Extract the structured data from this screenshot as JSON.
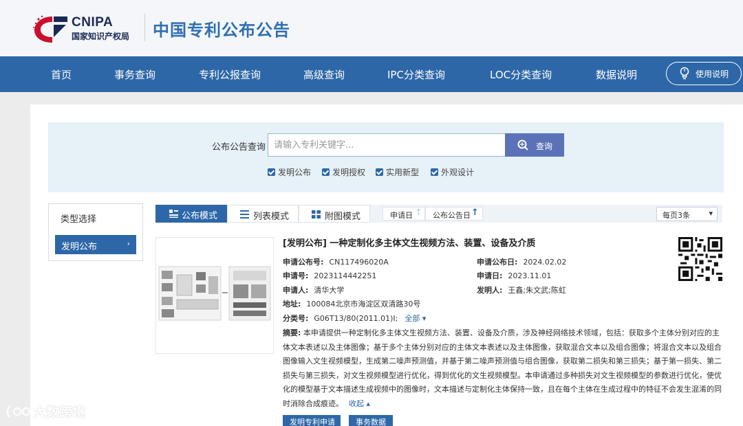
{
  "header": {
    "logo_en": "CNIPA",
    "logo_cn": "国家知识产权局",
    "site_title": "中国专利公布公告"
  },
  "nav": {
    "items": [
      "首页",
      "事务查询",
      "专利公报查询",
      "高级查询",
      "IPC分类查询",
      "LOC分类查询",
      "数据说明"
    ],
    "help_label": "使用说明"
  },
  "search": {
    "label": "公布公告查询",
    "placeholder": "请输入专利关键字...",
    "button_label": "查询",
    "checkboxes": [
      "发明公布",
      "发明授权",
      "实用新型",
      "外观设计"
    ]
  },
  "filter": {
    "title": "类型选择",
    "selected": "发明公布",
    "arrow": "›"
  },
  "toolbar": {
    "modes": [
      "公布模式",
      "列表模式",
      "附图模式"
    ],
    "sort_apply_date": "申请日",
    "sort_pub_date": "公布公告日",
    "per_page": "每页3条"
  },
  "result": {
    "title": "[发明公布] 一种定制化多主体文生视频方法、装置、设备及介质",
    "pub_no_label": "申请公布号:",
    "pub_no": "CN117496020A",
    "pub_date_label": "申请公布日:",
    "pub_date": "2024.02.02",
    "app_no_label": "申请号:",
    "app_no": "2023114442251",
    "app_date_label": "申请日:",
    "app_date": "2023.11.01",
    "applicant_label": "申请人:",
    "applicant": "清华大学",
    "inventor_label": "发明人:",
    "inventor": "王鑫;朱文武;陈虹",
    "address_label": "地址:",
    "address": "100084北京市海淀区双清路30号",
    "class_label": "分类号:",
    "class_no": "G06T13/80(2011.01)I;",
    "class_more": "全部 ▾",
    "abstract_label": "摘要:",
    "abstract": "本申请提供一种定制化多主体文生视频方法、装置、设备及介质，涉及神经网络技术领域，包括：获取多个主体分别对应的主体文本表述以及主体图像；基于多个主体分别对应的主体文本表述以及主体图像，获取混合文本以及组合图像；将混合文本以及组合图像输入文生视频模型，生成第二噪声预测值，并基于第二噪声预测值与组合图像，获取第二损失和第三损失；基于第一损失、第二损失与第三损失，对文生视频模型进行优化，得到优化的文生视频模型。本申请通过多种损失对文生视频模型的参数进行优化，使优化的模型基于文本描述生成视频中的图像时，文本描述与定制化主体保持一致，且在每个主体在生成过程中的特征不会发生混淆的同时消除合成痕迹。",
    "collapse": "收起 ▴",
    "actions": [
      "发明专利申请",
      "事务数据"
    ]
  },
  "watermark": "大数跨境",
  "colors": {
    "nav_bg": "#2d67a8",
    "search_btn": "#5b72b8",
    "title_blue": "#2f6fb1",
    "search_panel_bg": "#e6f1f8"
  },
  "icons": [
    "cnipa-logo-icon",
    "lightbulb-icon",
    "search-icon",
    "checkbox-checked-icon",
    "grid-icon",
    "list-icon",
    "sort-up-icon",
    "chevron-down-icon",
    "qr-code-icon"
  ]
}
